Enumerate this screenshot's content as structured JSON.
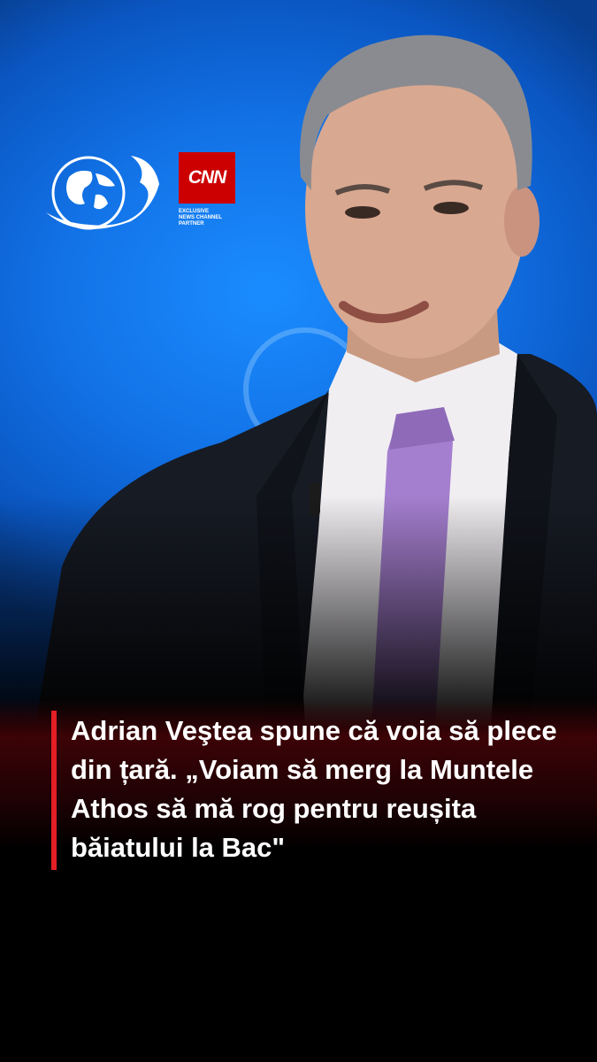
{
  "channel_logo": {
    "icon": "antena3-globe-3-logo",
    "color": "#ffffff"
  },
  "cnn_badge": {
    "label": "CNN",
    "partner_line_1": "EXCLUSIVE",
    "partner_line_2": "NEWS CHANNEL",
    "partner_line_3": "PARTNER",
    "color": "#cc0000"
  },
  "headline": {
    "text": "Adrian Veştea spune că voia să plece din țară. „Voiam să merg la Muntele Athos să mă rog pentru reușita băiatului la Bac\"",
    "accent_color": "#e31e24"
  },
  "colors": {
    "studio_blue": "#1272e6",
    "background": "#000000",
    "tie": "#a57fcf",
    "suit": "#171b24"
  }
}
